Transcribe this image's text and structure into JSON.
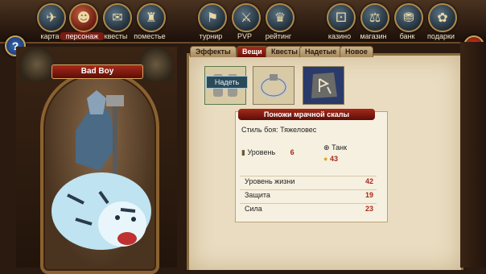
{
  "nav": {
    "items": [
      {
        "label": "карта",
        "icon": "map-icon",
        "glyph": "✈",
        "active": false
      },
      {
        "label": "персонаж",
        "icon": "character-icon",
        "glyph": "☻",
        "active": true
      },
      {
        "label": "квесты",
        "icon": "quests-icon",
        "glyph": "✉",
        "active": false
      },
      {
        "label": "поместье",
        "icon": "estate-icon",
        "glyph": "♜",
        "active": false
      },
      {
        "label": "турнир",
        "icon": "tournament-icon",
        "glyph": "⚑",
        "active": false
      },
      {
        "label": "PVP",
        "icon": "pvp-icon",
        "glyph": "⚔",
        "active": false
      },
      {
        "label": "рейтинг",
        "icon": "rating-icon",
        "glyph": "♛",
        "active": false
      },
      {
        "label": "казино",
        "icon": "casino-icon",
        "glyph": "⚀",
        "active": false
      },
      {
        "label": "магазин",
        "icon": "shop-icon",
        "glyph": "⚖",
        "active": false
      },
      {
        "label": "банк",
        "icon": "bank-icon",
        "glyph": "⛃",
        "active": false
      },
      {
        "label": "подарки",
        "icon": "gifts-icon",
        "glyph": "✿",
        "active": false
      }
    ]
  },
  "help": {
    "left": "?",
    "right": "!"
  },
  "character": {
    "name": "Bad Boy"
  },
  "tabs": [
    "Эффекты",
    "Вещи",
    "Квесты",
    "Надетые",
    "Новое"
  ],
  "active_tab": "Вещи",
  "inventory": {
    "equip_label": "Надеть",
    "items": [
      {
        "icon": "bracers-icon"
      },
      {
        "icon": "ring-icon"
      },
      {
        "icon": "rune-stone-icon"
      }
    ]
  },
  "item": {
    "title": "Поножи мрачной скалы",
    "fight_style": "Стиль боя: Тяжеловес",
    "level_label": "Уровень",
    "level_value": "6",
    "class": "Танк",
    "price": "43",
    "stats": [
      {
        "label": "Уровень жизни",
        "value": "42"
      },
      {
        "label": "Защита",
        "value": "19"
      },
      {
        "label": "Сила",
        "value": "23"
      }
    ]
  },
  "colors": {
    "accent": "#a82a1a",
    "parchment": "#e9dcc0",
    "frame": "#8a6a3a"
  }
}
